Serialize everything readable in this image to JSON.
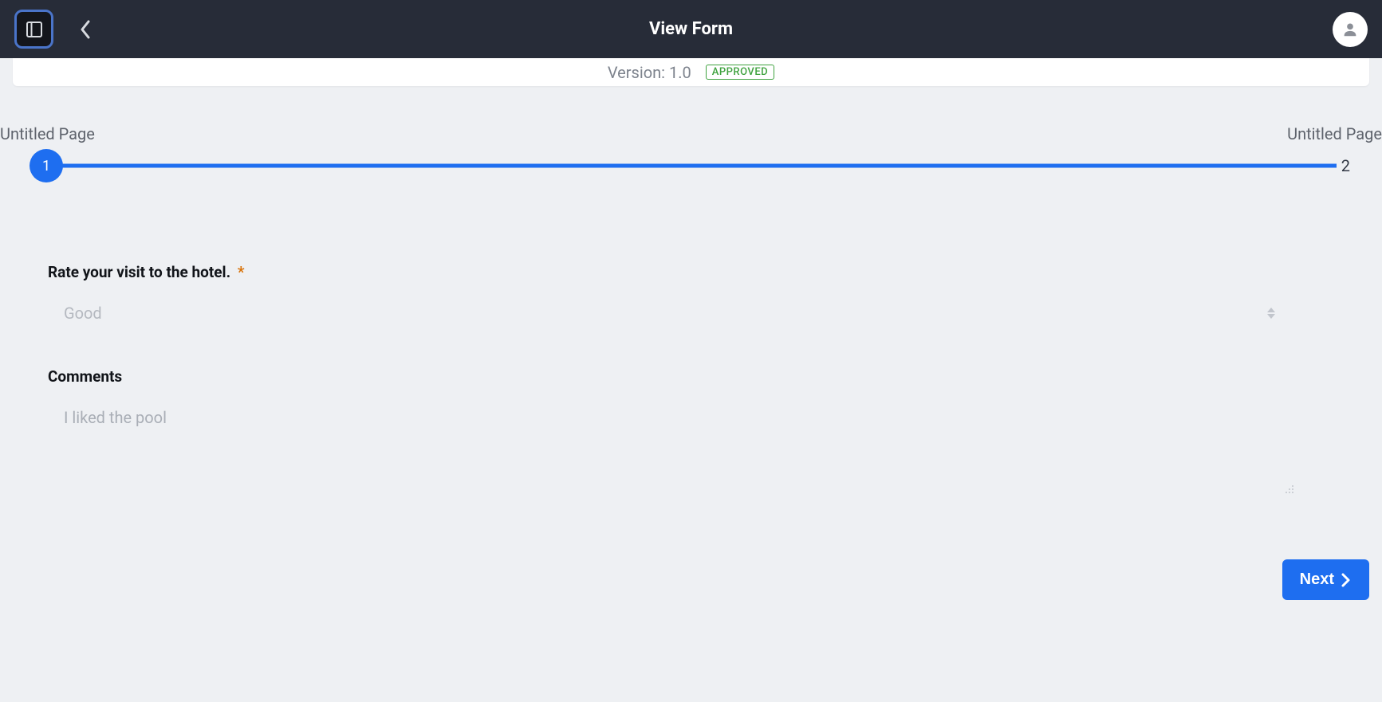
{
  "header": {
    "title": "View Form"
  },
  "version": {
    "label": "Version: 1.0",
    "status": "APPROVED"
  },
  "stepper": {
    "steps": [
      {
        "label": "Untitled Page",
        "number": "1"
      },
      {
        "label": "Untitled Page",
        "number": "2"
      }
    ]
  },
  "form": {
    "rating": {
      "label": "Rate your visit to the hotel.",
      "required_mark": "*",
      "value": "Good"
    },
    "comments": {
      "label": "Comments",
      "value": "I liked the pool"
    }
  },
  "footer": {
    "next_label": "Next"
  }
}
